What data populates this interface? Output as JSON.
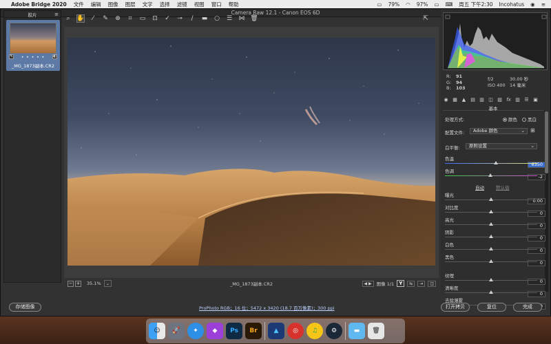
{
  "menubar": {
    "app_name": "Adobe Bridge 2020",
    "items": [
      "文件",
      "编辑",
      "图像",
      "图层",
      "文字",
      "选择",
      "滤镜",
      "视图",
      "窗口",
      "帮助"
    ],
    "battery_icon_pct": "79%",
    "battery": "97%",
    "clock": "周五 下午2:30",
    "user": "Incohatus"
  },
  "window": {
    "title": "Camera Raw 12.1  -  Canon EOS 6D"
  },
  "filmstrip": {
    "title": "胶片",
    "thumb_label": "_MG_1873副本.CR2",
    "thumb_dots": "• • • • •"
  },
  "toolbar": {
    "tools": [
      "zoom-tool",
      "hand-tool",
      "white-balance-tool",
      "color-sampler-tool",
      "targeted-adjustment-tool",
      "crop-tool",
      "straighten-tool",
      "transform-tool",
      "spot-removal-tool",
      "red-eye-tool",
      "adjustment-brush",
      "graduated-filter",
      "radial-filter",
      "preferences",
      "rotate-tool",
      "trash-tool"
    ]
  },
  "canvas": {
    "zoom": "35.1%",
    "filename": "_MG_1873副本.CR2",
    "image_count": "图像 1/1"
  },
  "info": {
    "r_label": "R:",
    "r": "91",
    "g_label": "G:",
    "g": "94",
    "b_label": "B:",
    "b": "103",
    "aperture": "f/2",
    "shutter": "30.00 秒",
    "iso": "ISO 400",
    "focal": "14 毫米"
  },
  "basic": {
    "section_title": "基本",
    "treatment_label": "处理方式:",
    "treatment_color": "颜色",
    "treatment_bw": "黑白",
    "profile_label": "配置文件:",
    "profile_value": "Adobe 颜色",
    "wb_label": "白平衡:",
    "wb_value": "原照设置",
    "temp_label": "色温",
    "temp_value": "6350",
    "temp_level": 0.55,
    "tint_label": "色调",
    "tint_value": "-2",
    "tint_level": 0.49,
    "auto_label": "自动",
    "default_label": "默认值",
    "sliders": [
      {
        "label": "曝光",
        "value": "0.00",
        "level": 0.5
      },
      {
        "label": "对比度",
        "value": "0",
        "level": 0.5
      },
      {
        "label": "高光",
        "value": "0",
        "level": 0.5
      },
      {
        "label": "阴影",
        "value": "0",
        "level": 0.5
      },
      {
        "label": "白色",
        "value": "0",
        "level": 0.5
      },
      {
        "label": "黑色",
        "value": "0",
        "level": 0.5
      }
    ],
    "presence": [
      {
        "label": "纹理",
        "value": "0",
        "level": 0.5
      },
      {
        "label": "清晰度",
        "value": "0",
        "level": 0.5
      },
      {
        "label": "去除薄雾",
        "value": "0",
        "level": 0.5
      }
    ]
  },
  "footer": {
    "save": "存储图像",
    "workflow": "ProPhoto RGB；16 位；5472 x 3420 (18.7 百万像素)；300 ppi",
    "open_copy": "打开拷贝",
    "reset": "复位",
    "done": "完成"
  },
  "dock": {
    "apps": [
      "finder-icon",
      "launchpad-icon",
      "safari-icon",
      "affinity-photo-icon",
      "photoshop-icon",
      "bridge-icon",
      "affinity-designer-icon",
      "netease-music-icon",
      "qq-music-icon",
      "steam-icon",
      "folder-icon",
      "trash-icon"
    ],
    "ps_text": "Ps",
    "br_text": "Br"
  }
}
